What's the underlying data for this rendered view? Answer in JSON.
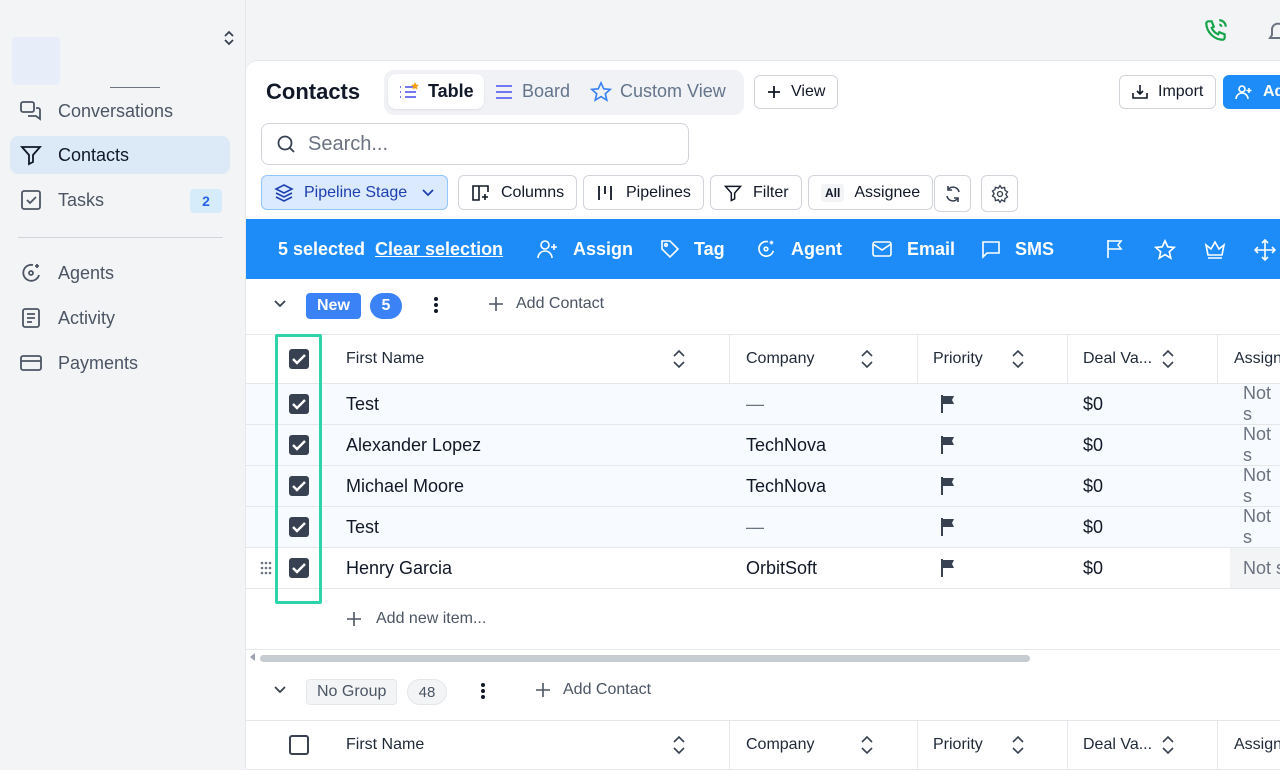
{
  "sidebar": {
    "items": [
      {
        "label": "Conversations",
        "icon": "conversations-icon"
      },
      {
        "label": "Contacts",
        "icon": "filter-icon"
      },
      {
        "label": "Tasks",
        "icon": "tasks-icon",
        "badge": "2"
      },
      {
        "label": "Agents",
        "icon": "agents-icon"
      },
      {
        "label": "Activity",
        "icon": "activity-icon"
      },
      {
        "label": "Payments",
        "icon": "payments-icon"
      }
    ]
  },
  "header": {
    "title": "Contacts",
    "views": [
      {
        "label": "Table",
        "icon": "list-icon"
      },
      {
        "label": "Board",
        "icon": "board-icon"
      },
      {
        "label": "Custom View",
        "icon": "star-icon"
      }
    ],
    "add_view": "View",
    "import": "Import",
    "add": "Add"
  },
  "search": {
    "placeholder": "Search..."
  },
  "filters": {
    "pipeline_stage": "Pipeline Stage",
    "columns": "Columns",
    "pipelines": "Pipelines",
    "filter": "Filter",
    "all_chip": "All",
    "assignee": "Assignee"
  },
  "selection": {
    "count": "5 selected",
    "clear": "Clear selection",
    "actions": [
      "Assign",
      "Tag",
      "Agent",
      "Email",
      "SMS"
    ]
  },
  "columns": [
    "First Name",
    "Company",
    "Priority",
    "Deal Va...",
    "Assign"
  ],
  "groups": [
    {
      "name": "New",
      "count": "5",
      "add_contact": "Add Contact",
      "rows": [
        {
          "name": "Test",
          "company": "—",
          "deal": "$0",
          "assign": "Not s"
        },
        {
          "name": "Alexander Lopez",
          "company": "TechNova",
          "deal": "$0",
          "assign": "Not s"
        },
        {
          "name": "Michael Moore",
          "company": "TechNova",
          "deal": "$0",
          "assign": "Not s"
        },
        {
          "name": "Test",
          "company": "—",
          "deal": "$0",
          "assign": "Not s"
        },
        {
          "name": "Henry Garcia",
          "company": "OrbitSoft",
          "deal": "$0",
          "assign": "Not s"
        }
      ],
      "add_item": "Add new item..."
    },
    {
      "name": "No Group",
      "count": "48",
      "add_contact": "Add Contact"
    }
  ],
  "colors": {
    "accent": "#1d8cf8",
    "highlight": "#2dd4aa",
    "badge_blue": "#3b82f6"
  }
}
